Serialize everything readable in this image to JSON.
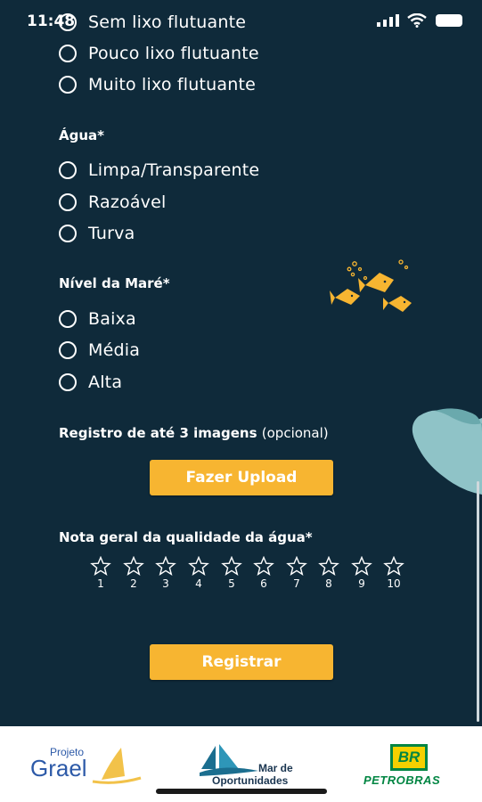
{
  "status_bar": {
    "time": "11:48"
  },
  "lixo_options": [
    "Sem lixo flutuante",
    "Pouco lixo flutuante",
    "Muito lixo flutuante"
  ],
  "agua": {
    "label": "Água*",
    "options": [
      "Limpa/Transparente",
      "Razoável",
      "Turva"
    ]
  },
  "mare": {
    "label": "Nível da Maré*",
    "options": [
      "Baixa",
      "Média",
      "Alta"
    ]
  },
  "imagens": {
    "label": "Registro de até 3 imagens",
    "optional": "(opcional)",
    "upload_label": "Fazer Upload"
  },
  "nota": {
    "label": "Nota geral da qualidade da água*",
    "scale": [
      "1",
      "2",
      "3",
      "4",
      "5",
      "6",
      "7",
      "8",
      "9",
      "10"
    ]
  },
  "submit_label": "Registrar",
  "footer": {
    "logo_grael": {
      "small": "Projeto",
      "big": "Grael"
    },
    "logo_mar": {
      "line1": "Mar de",
      "line2": "Oportunidades"
    },
    "logo_petrobras": {
      "badge": "BR",
      "name": "PETROBRAS"
    }
  },
  "colors": {
    "background": "#0f2a3a",
    "accent": "#f7b531",
    "text": "#ffffff",
    "petrobras_green": "#008542"
  },
  "icons": [
    "radio-unselected-icon",
    "star-outline-icon",
    "fish-school-icon"
  ]
}
